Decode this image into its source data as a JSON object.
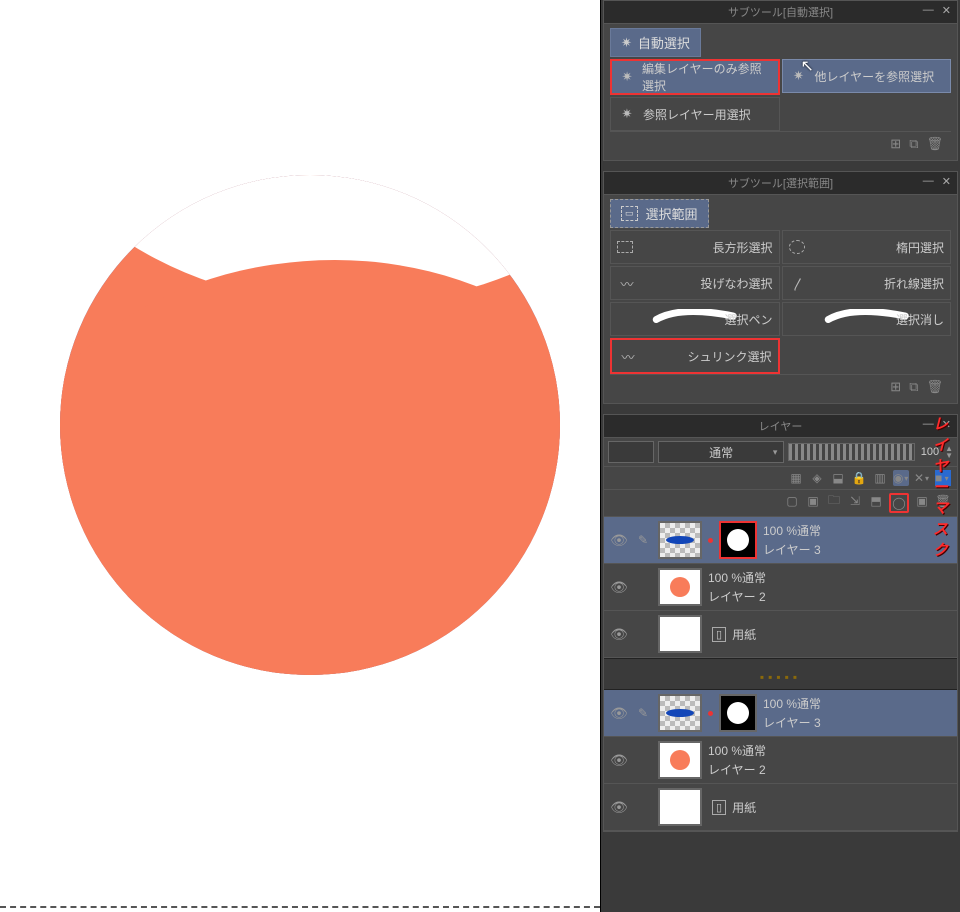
{
  "auto_select_panel": {
    "title": "サブツール[自動選択]",
    "tab": "自動選択",
    "tools": {
      "only_edit_layer": "編集レイヤーのみ参照選択",
      "other_layers": "他レイヤーを参照選択",
      "ref_layer": "参照レイヤー用選択"
    }
  },
  "selection_panel": {
    "title": "サブツール[選択範囲]",
    "tab": "選択範囲",
    "tools": {
      "rect": "長方形選択",
      "ellipse": "楕円選択",
      "lasso": "投げなわ選択",
      "polyline": "折れ線選択",
      "select_pen": "選択ペン",
      "select_erase": "選択消し",
      "shrink": "シュリンク選択"
    }
  },
  "layer_panel": {
    "title": "レイヤー",
    "blend_mode": "通常",
    "opacity": "100",
    "mask_annotation": "レイヤーマスク",
    "layers_a": [
      {
        "mode": "100 %通常",
        "name": "レイヤー 3",
        "kind": "blue_mask",
        "selected": true,
        "mask_hl": true
      },
      {
        "mode": "100 %通常",
        "name": "レイヤー 2",
        "kind": "orange"
      },
      {
        "mode": "",
        "name": "用紙",
        "kind": "paper"
      }
    ],
    "layers_b": [
      {
        "mode": "100 %通常",
        "name": "レイヤー 3",
        "kind": "blue_mask",
        "selected": true,
        "mask_hl": false
      },
      {
        "mode": "100 %通常",
        "name": "レイヤー 2",
        "kind": "orange"
      },
      {
        "mode": "",
        "name": "用紙",
        "kind": "paper"
      }
    ]
  },
  "icons": {
    "minimize": "—",
    "close": "✕",
    "new": "⊞",
    "dup": "⧉",
    "del": "🗑",
    "arrow": "▾",
    "eye": "👁",
    "pen": "✎",
    "lock": "🔒",
    "dot": "•",
    "star": "✷",
    "dashed_rect": "▭",
    "circle": "◯",
    "lasso": "〰",
    "polyline": "〳",
    "shrink": "◐",
    "folder": "🗀"
  }
}
